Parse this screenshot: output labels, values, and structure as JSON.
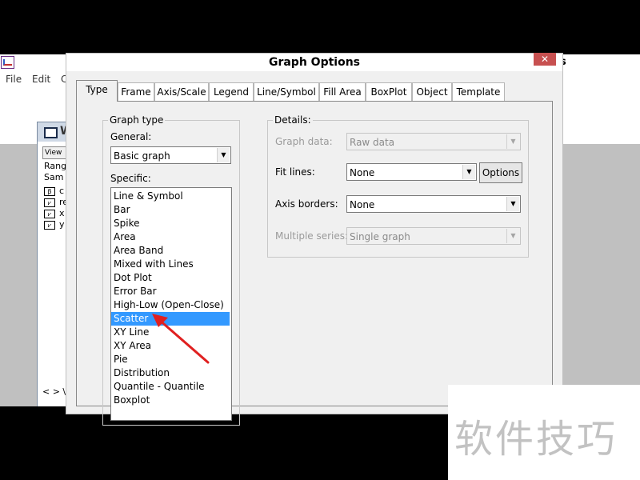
{
  "app": {
    "title_right": "s",
    "menu": [
      "File",
      "Edit",
      "C"
    ]
  },
  "subwindow": {
    "title": "W",
    "view_button": "View",
    "range_label": "Rang",
    "sample_label": "Sam",
    "objects": [
      {
        "icon": "β",
        "label": "c"
      },
      {
        "icon": "",
        "label": "re"
      },
      {
        "icon": "",
        "label": "x"
      },
      {
        "icon": "",
        "label": "y"
      }
    ],
    "nav": "< > \\"
  },
  "dialog": {
    "title": "Graph Options",
    "close": "✕",
    "tabs": [
      "Type",
      "Frame",
      "Axis/Scale",
      "Legend",
      "Line/Symbol",
      "Fill Area",
      "BoxPlot",
      "Object",
      "Template"
    ],
    "active_tab": "Type",
    "graph_type": {
      "group_label": "Graph type",
      "general_label": "General:",
      "general_value": "Basic graph",
      "specific_label": "Specific:",
      "specific_items": [
        "Line & Symbol",
        "Bar",
        "Spike",
        "Area",
        "Area Band",
        "Mixed with Lines",
        "Dot Plot",
        "Error Bar",
        "High-Low (Open-Close)",
        "Scatter",
        "XY Line",
        "XY Area",
        "Pie",
        "Distribution",
        "Quantile - Quantile",
        "Boxplot"
      ],
      "selected_item": "Scatter"
    },
    "details": {
      "group_label": "Details:",
      "graph_data_label": "Graph data:",
      "graph_data_value": "Raw data",
      "fit_lines_label": "Fit lines:",
      "fit_lines_value": "None",
      "options_button": "Options",
      "axis_borders_label": "Axis borders:",
      "axis_borders_value": "None",
      "multiple_series_label": "Multiple series:",
      "multiple_series_value": "Single graph"
    }
  },
  "watermark": "软件技巧",
  "colors": {
    "selection": "#3399ff",
    "annotation_arrow": "#e02020",
    "close_button": "#c75050"
  }
}
